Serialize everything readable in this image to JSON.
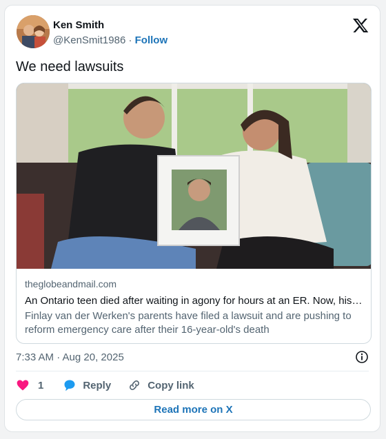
{
  "author": {
    "name": "Ken Smith",
    "handle": "@KenSmit1986",
    "separator": "·",
    "follow_label": "Follow"
  },
  "tweet": {
    "text": "We need lawsuits"
  },
  "link_card": {
    "domain": "theglobeandmail.com",
    "headline": "An Ontario teen died after waiting in agony for hours at an ER. Now, his parents are calling for change",
    "description": "Finlay van der Werken's parents have filed a lawsuit and are pushing to reform emergency care after their 16-year-old's death"
  },
  "meta": {
    "timestamp": "7:33 AM · Aug 20, 2025"
  },
  "actions": {
    "like_count": "1",
    "reply_label": "Reply",
    "copy_label": "Copy link"
  },
  "read_more_label": "Read more on X",
  "icons": {
    "logo": "x-logo-icon",
    "info": "info-icon",
    "like": "heart-icon",
    "reply": "speech-bubble-icon",
    "copy": "link-icon"
  },
  "colors": {
    "accent": "#1d74b8",
    "like": "#f91880",
    "reply": "#1d9bf0",
    "muted": "#536471"
  }
}
